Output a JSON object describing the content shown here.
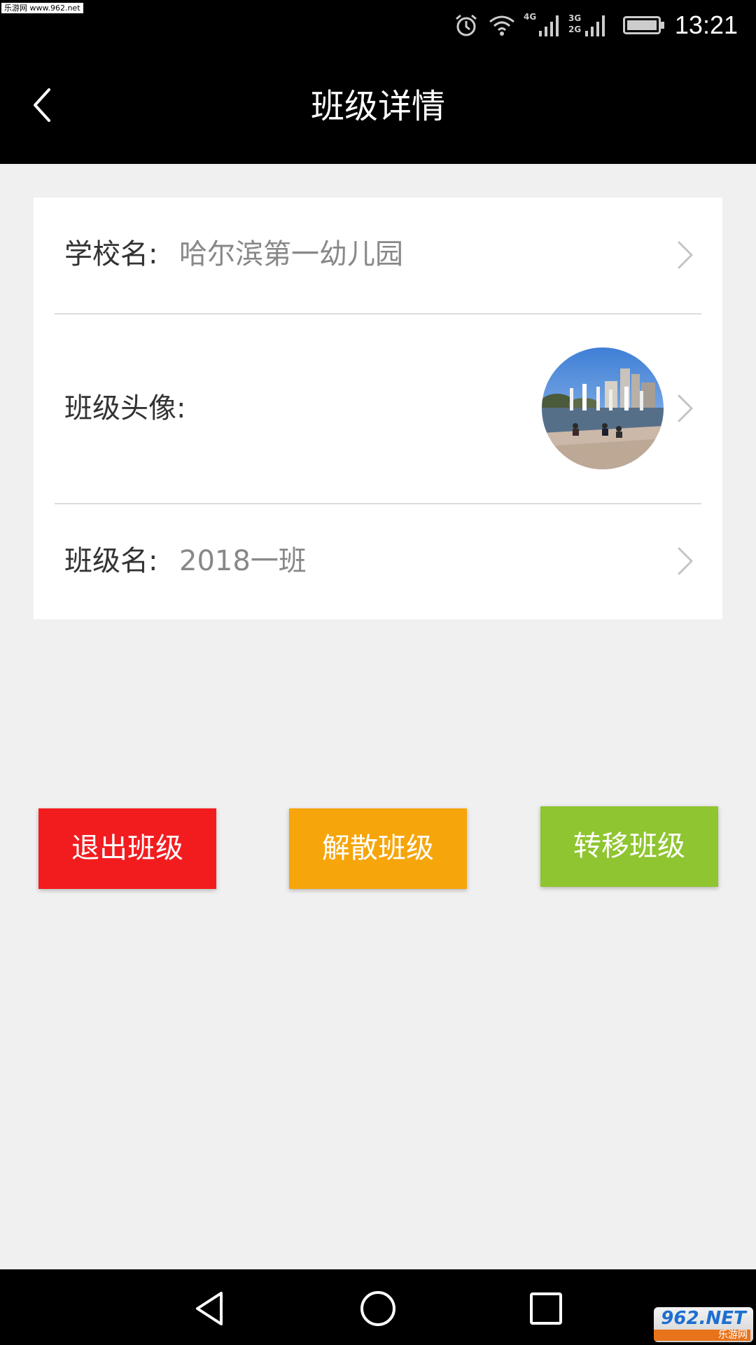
{
  "watermark": {
    "top_text": "乐游网 www.962.net",
    "logo_main": "962.NET",
    "logo_sub": "乐游网"
  },
  "status_bar": {
    "time": "13:21",
    "network_label_1": "4G",
    "network_label_2": "3G",
    "network_label_3": "2G",
    "icons": [
      "alarm-icon",
      "wifi-icon",
      "signal-4g-icon",
      "signal-3g-2g-icon",
      "battery-icon"
    ]
  },
  "header": {
    "title": "班级详情",
    "back_icon": "chevron-left-icon"
  },
  "details": {
    "school": {
      "label": "学校名:",
      "value": "哈尔滨第一幼儿园"
    },
    "avatar": {
      "label": "班级头像:",
      "image": "fountain-photo"
    },
    "class_name": {
      "label": "班级名:",
      "value": "2018一班"
    }
  },
  "actions": {
    "exit_label": "退出班级",
    "dissolve_label": "解散班级",
    "transfer_label": "转移班级"
  },
  "colors": {
    "header_bg": "#000000",
    "page_bg": "#f0f0f0",
    "exit": "#f21c1f",
    "dissolve": "#f6a50a",
    "transfer": "#8fc530"
  },
  "navigation": {
    "buttons": [
      "nav-back-icon",
      "nav-home-icon",
      "nav-recent-icon"
    ]
  }
}
